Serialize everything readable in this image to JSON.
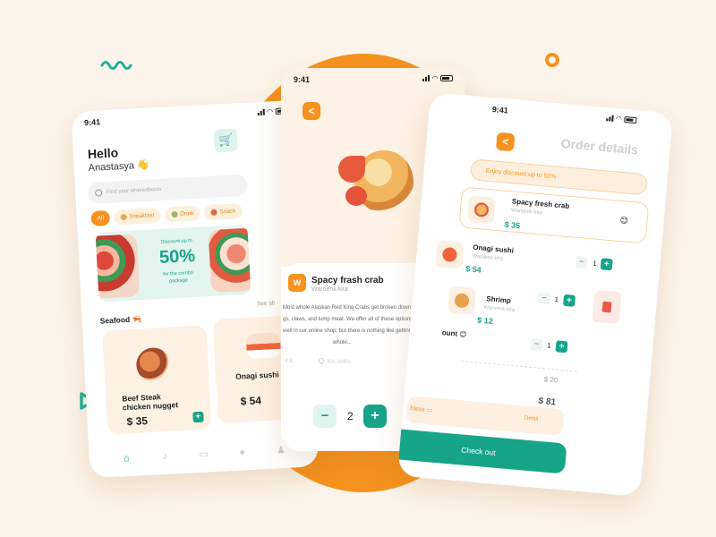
{
  "colors": {
    "background": "#fcf4ea",
    "accent_orange": "#f6921e",
    "accent_green": "#16a587"
  },
  "home": {
    "time": "9:41",
    "greeting": "Hello",
    "user_name": "Anastasya",
    "wave_icon": "👋",
    "search_placeholder": "Find your whereabouts",
    "categories": [
      {
        "label": "All"
      },
      {
        "label": "Breakfast"
      },
      {
        "label": "Drink"
      },
      {
        "label": "Snack"
      }
    ],
    "banner": {
      "line1": "Discount up to",
      "percent": "50%",
      "line2": "for the combo",
      "line3": "package"
    },
    "see_all": "See all",
    "section_title": "Seafood",
    "section_icon": "🦐",
    "cards": [
      {
        "name_line1": "Beef Steak",
        "name_line2": "chicken nugget",
        "price": "$ 35",
        "add": "+"
      },
      {
        "name": "Onagi sushi",
        "price": "$ 54"
      }
    ]
  },
  "detail": {
    "time": "9:41",
    "back": "<",
    "badge": "W",
    "name": "Spacy frash crab",
    "store": "Waroenk kita",
    "description": [
      "Most whole Alaskan Red King Crabs get broken down into",
      "gs, claws, and lump meat. We offer all of these options",
      "well in our online shop, but there is nothing like getting",
      "whole..."
    ],
    "rating": "4.8",
    "location": "Kh. Arifin",
    "minus": "−",
    "quantity": "2",
    "plus": "+"
  },
  "order": {
    "time": "9:41",
    "back": "<",
    "title": "Order details",
    "discount_text": "Enjoy discount up to 50%",
    "items": [
      {
        "name": "Spacy fresh crab",
        "store": "Waroenk kita",
        "price": "$ 35"
      },
      {
        "name": "Onagi sushi",
        "store": "Waroenk kita",
        "price": "$ 54",
        "minus": "−",
        "qty": "1",
        "plus": "+"
      },
      {
        "name": "Shrimp",
        "store": "Waroenk kita",
        "price": "$ 12",
        "minus": "−",
        "qty": "1",
        "plus": "+"
      }
    ],
    "extra_row": {
      "minus": "−",
      "qty": "1",
      "plus": "+"
    },
    "discount_label": "ount",
    "subtotal": "$ 20",
    "total": "$ 81",
    "payment_label": "hless",
    "payment_detail": "Detail",
    "checkout": "Check out"
  }
}
